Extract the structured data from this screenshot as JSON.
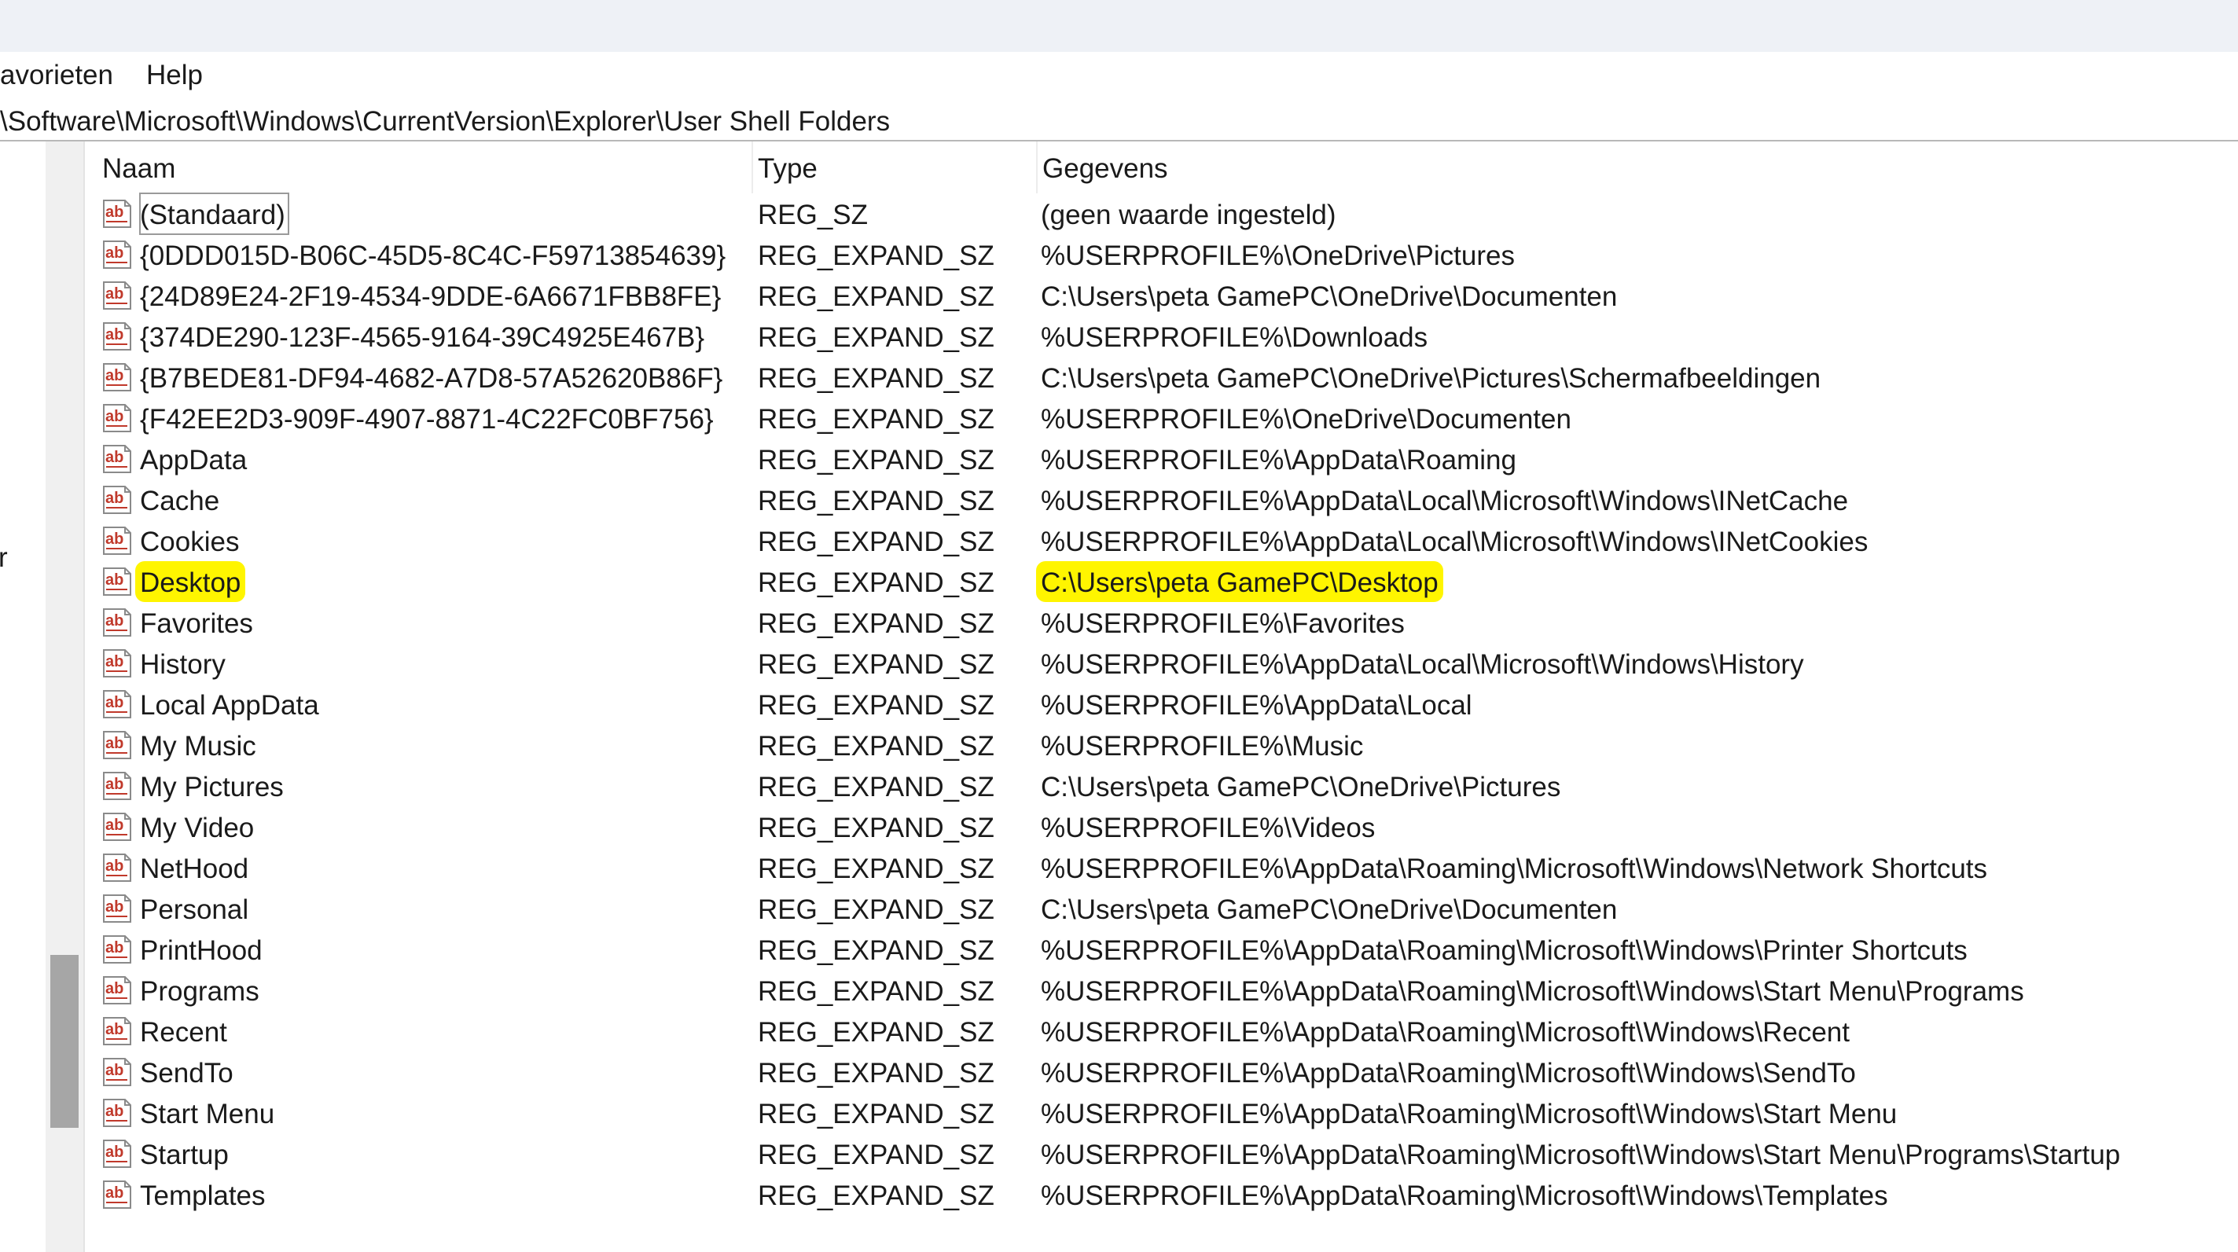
{
  "menubar": {
    "favorites": "avorieten",
    "help": "Help"
  },
  "address": {
    "path": "\\Software\\Microsoft\\Windows\\CurrentVersion\\Explorer\\User Shell Folders"
  },
  "tree": {
    "fragment": "r"
  },
  "list": {
    "columns": {
      "name": "Naam",
      "type": "Type",
      "data": "Gegevens"
    },
    "icon": "reg-string-ab-icon",
    "rows": [
      {
        "name": "(Standaard)",
        "type": "REG_SZ",
        "data": "(geen waarde ingesteld)"
      },
      {
        "name": "{0DDD015D-B06C-45D5-8C4C-F59713854639}",
        "type": "REG_EXPAND_SZ",
        "data": "%USERPROFILE%\\OneDrive\\Pictures"
      },
      {
        "name": "{24D89E24-2F19-4534-9DDE-6A6671FBB8FE}",
        "type": "REG_EXPAND_SZ",
        "data": "C:\\Users\\peta GamePC\\OneDrive\\Documenten"
      },
      {
        "name": "{374DE290-123F-4565-9164-39C4925E467B}",
        "type": "REG_EXPAND_SZ",
        "data": "%USERPROFILE%\\Downloads"
      },
      {
        "name": "{B7BEDE81-DF94-4682-A7D8-57A52620B86F}",
        "type": "REG_EXPAND_SZ",
        "data": "C:\\Users\\peta GamePC\\OneDrive\\Pictures\\Schermafbeeldingen"
      },
      {
        "name": "{F42EE2D3-909F-4907-8871-4C22FC0BF756}",
        "type": "REG_EXPAND_SZ",
        "data": "%USERPROFILE%\\OneDrive\\Documenten"
      },
      {
        "name": "AppData",
        "type": "REG_EXPAND_SZ",
        "data": "%USERPROFILE%\\AppData\\Roaming"
      },
      {
        "name": "Cache",
        "type": "REG_EXPAND_SZ",
        "data": "%USERPROFILE%\\AppData\\Local\\Microsoft\\Windows\\INetCache"
      },
      {
        "name": "Cookies",
        "type": "REG_EXPAND_SZ",
        "data": "%USERPROFILE%\\AppData\\Local\\Microsoft\\Windows\\INetCookies"
      },
      {
        "name": "Desktop",
        "type": "REG_EXPAND_SZ",
        "data": "C:\\Users\\peta GamePC\\Desktop"
      },
      {
        "name": "Favorites",
        "type": "REG_EXPAND_SZ",
        "data": "%USERPROFILE%\\Favorites"
      },
      {
        "name": "History",
        "type": "REG_EXPAND_SZ",
        "data": "%USERPROFILE%\\AppData\\Local\\Microsoft\\Windows\\History"
      },
      {
        "name": "Local AppData",
        "type": "REG_EXPAND_SZ",
        "data": "%USERPROFILE%\\AppData\\Local"
      },
      {
        "name": "My Music",
        "type": "REG_EXPAND_SZ",
        "data": "%USERPROFILE%\\Music"
      },
      {
        "name": "My Pictures",
        "type": "REG_EXPAND_SZ",
        "data": "C:\\Users\\peta GamePC\\OneDrive\\Pictures"
      },
      {
        "name": "My Video",
        "type": "REG_EXPAND_SZ",
        "data": "%USERPROFILE%\\Videos"
      },
      {
        "name": "NetHood",
        "type": "REG_EXPAND_SZ",
        "data": "%USERPROFILE%\\AppData\\Roaming\\Microsoft\\Windows\\Network Shortcuts"
      },
      {
        "name": "Personal",
        "type": "REG_EXPAND_SZ",
        "data": "C:\\Users\\peta GamePC\\OneDrive\\Documenten"
      },
      {
        "name": "PrintHood",
        "type": "REG_EXPAND_SZ",
        "data": "%USERPROFILE%\\AppData\\Roaming\\Microsoft\\Windows\\Printer Shortcuts"
      },
      {
        "name": "Programs",
        "type": "REG_EXPAND_SZ",
        "data": "%USERPROFILE%\\AppData\\Roaming\\Microsoft\\Windows\\Start Menu\\Programs"
      },
      {
        "name": "Recent",
        "type": "REG_EXPAND_SZ",
        "data": "%USERPROFILE%\\AppData\\Roaming\\Microsoft\\Windows\\Recent"
      },
      {
        "name": "SendTo",
        "type": "REG_EXPAND_SZ",
        "data": "%USERPROFILE%\\AppData\\Roaming\\Microsoft\\Windows\\SendTo"
      },
      {
        "name": "Start Menu",
        "type": "REG_EXPAND_SZ",
        "data": "%USERPROFILE%\\AppData\\Roaming\\Microsoft\\Windows\\Start Menu"
      },
      {
        "name": "Startup",
        "type": "REG_EXPAND_SZ",
        "data": "%USERPROFILE%\\AppData\\Roaming\\Microsoft\\Windows\\Start Menu\\Programs\\Startup"
      },
      {
        "name": "Templates",
        "type": "REG_EXPAND_SZ",
        "data": "%USERPROFILE%\\AppData\\Roaming\\Microsoft\\Windows\\Templates"
      }
    ]
  },
  "colors": {
    "highlight": "#fff500",
    "icon_text": "#c0392b",
    "scroll_thumb": "#a6a6a6"
  }
}
